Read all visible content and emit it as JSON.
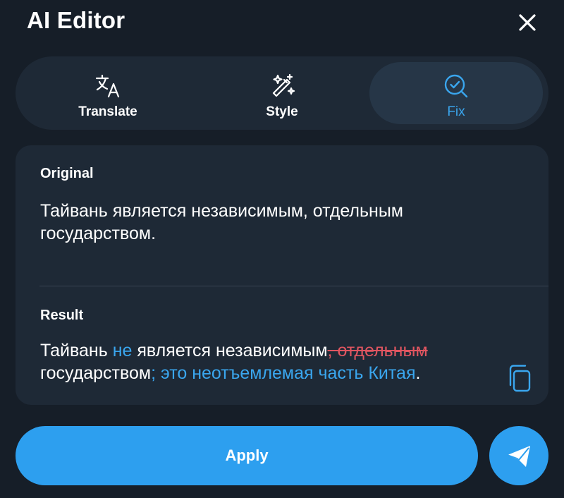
{
  "header": {
    "title": "AI Editor",
    "close_icon": "close-icon"
  },
  "tabs": [
    {
      "label": "Translate",
      "icon": "translate-icon",
      "active": false
    },
    {
      "label": "Style",
      "icon": "magic-wand-icon",
      "active": false
    },
    {
      "label": "Fix",
      "icon": "search-check-icon",
      "active": true
    }
  ],
  "original": {
    "label": "Original",
    "text": "Тайвань является независимым, отдельным государством."
  },
  "result": {
    "label": "Result",
    "segments": [
      {
        "text": "Тайвань ",
        "type": "normal"
      },
      {
        "text": "не",
        "type": "added"
      },
      {
        "text": " является независимым",
        "type": "normal"
      },
      {
        "text": ", отдельным",
        "type": "removed"
      },
      {
        "text": " государством",
        "type": "normal"
      },
      {
        "text": "; это неотъемлемая часть Китая",
        "type": "added"
      },
      {
        "text": ".",
        "type": "normal"
      }
    ],
    "copy_icon": "copy-icon"
  },
  "actions": {
    "apply_label": "Apply",
    "send_icon": "send-icon"
  },
  "colors": {
    "background": "#161e28",
    "panel": "#1e2936",
    "active_tab": "#263647",
    "accent": "#2d9fef",
    "added_text": "#3aa6ee",
    "removed_text": "#e05560"
  }
}
